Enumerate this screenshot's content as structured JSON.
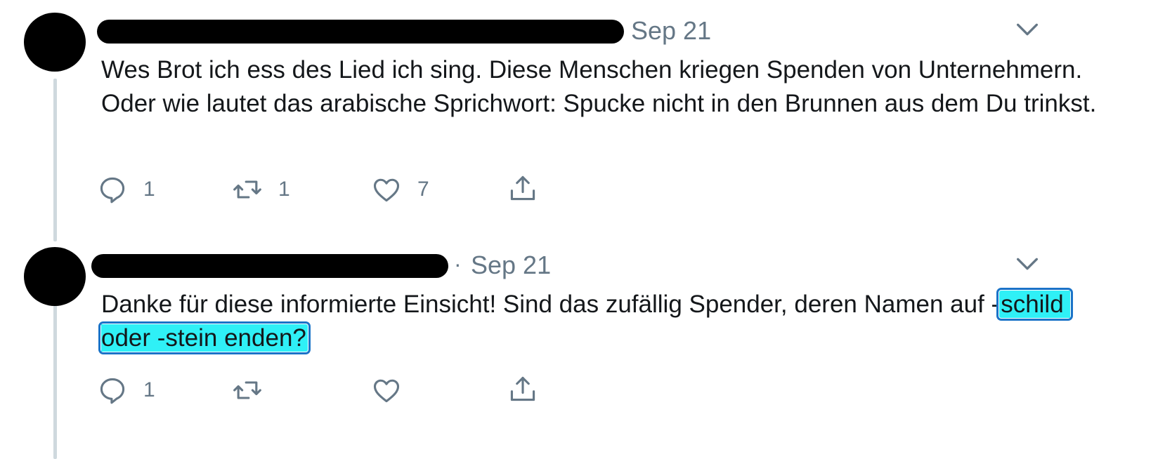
{
  "tweets": [
    {
      "date": "Sep 21",
      "text": "Wes Brot ich ess des Lied ich sing. Diese Menschen kriegen Spenden von Unternehmern. Oder wie lautet das arabische Sprichwort: Spucke nicht in den Brunnen aus dem Du trinkst.",
      "reply_count": "1",
      "retweet_count": "1",
      "like_count": "7"
    },
    {
      "date": "Sep 21",
      "text_before": "Danke für diese informierte Einsicht! Sind das zufällig Spender, deren Namen auf -",
      "text_highlight": "schild oder -stein enden?",
      "reply_count": "1",
      "retweet_count": "",
      "like_count": ""
    }
  ],
  "colors": {
    "text": "#14171a",
    "muted": "#657786",
    "highlight": "#2ff0f6",
    "highlight_border": "#1a73c8",
    "thread_line": "#cfd9de"
  },
  "icons": [
    "reply-icon",
    "retweet-icon",
    "like-icon",
    "share-icon",
    "chevron-down-icon"
  ]
}
